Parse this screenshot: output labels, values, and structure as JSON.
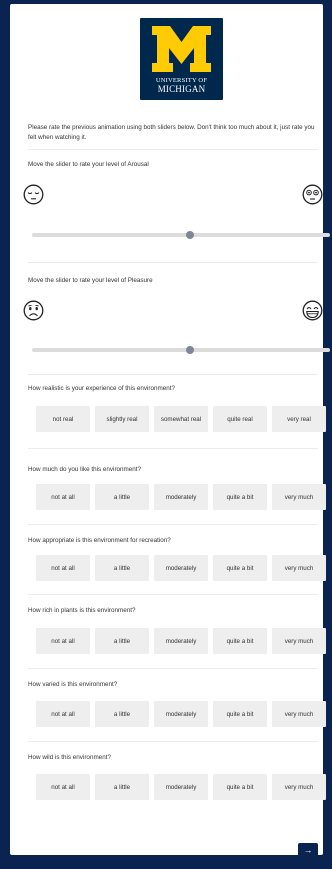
{
  "logo": {
    "line1": "UNIVERSITY OF",
    "line2": "MICHIGAN",
    "block_letter": "M",
    "brand_blue": "#00274c",
    "brand_maize": "#ffcb05"
  },
  "intro": "Please rate the previous animation using both sliders below. Don't think too much about it, just rate you felt when watching it.",
  "sliders": [
    {
      "prompt": "Move the slider to rate your level of Arousal",
      "left_icon": "sleepy-face-icon",
      "right_icon": "wide-eyed-face-icon",
      "value": 0.53
    },
    {
      "prompt": "Move the slider to rate your level of Pleasure",
      "left_icon": "frowning-face-icon",
      "right_icon": "grinning-face-icon",
      "value": 0.53
    }
  ],
  "questions": [
    {
      "prompt": "How realistic is your experience of this environment?",
      "options": [
        "not real",
        "slightly real",
        "somewhat real",
        "quite real",
        "very real"
      ]
    },
    {
      "prompt": "How much do you like this environment?",
      "options": [
        "not at all",
        "a little",
        "moderately",
        "quite a bit",
        "very much"
      ]
    },
    {
      "prompt": "How appropriate is this environment for recreation?",
      "options": [
        "not at all",
        "a little",
        "moderately",
        "quite a bit",
        "very much"
      ]
    },
    {
      "prompt": "How rich in plants is this environment?",
      "options": [
        "not at all",
        "a little",
        "moderately",
        "quite a bit",
        "very much"
      ]
    },
    {
      "prompt": "How varied is this environment?",
      "options": [
        "not at all",
        "a little",
        "moderately",
        "quite a bit",
        "very much"
      ]
    },
    {
      "prompt": "How wild is this environment?",
      "options": [
        "not at all",
        "a little",
        "moderately",
        "quite a bit",
        "very much"
      ]
    }
  ],
  "next_button": {
    "label": "→"
  }
}
